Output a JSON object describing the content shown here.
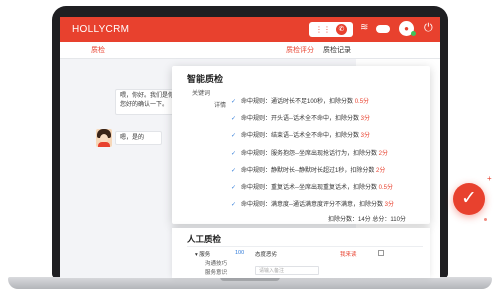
{
  "app": {
    "brand": "HOLLYCRM"
  },
  "topbar": {
    "grid_icon": "grid-icon",
    "phone_icon": "phone-icon",
    "wifi_icon": "wifi-icon",
    "avatar_icon": "user-avatar-icon",
    "power_icon": "power-icon",
    "accent": "#e8412e"
  },
  "tabs": {
    "qc": "质检",
    "score": "质检评分",
    "record": "质检记录"
  },
  "chat": {
    "agent_message": "喂，你好。我们是你您好的确认一下。",
    "customer_message": "嗯，是的"
  },
  "smart_qc": {
    "title": "智能质检",
    "keyword_label": "关键词",
    "detail_label": "详情",
    "rules": [
      {
        "text": "命中规则：通话时长不足100秒，扣除分数",
        "deduct": "0.5分"
      },
      {
        "text": "命中规则：开头语--话术全不命中，扣除分数",
        "deduct": "3分"
      },
      {
        "text": "命中规则：结束语--话术全不命中，扣除分数",
        "deduct": "3分"
      },
      {
        "text": "命中规则：服务抱怨--坐席出现抢话行为，扣除分数",
        "deduct": "2分"
      },
      {
        "text": "命中规则：静默时长--静默时长超过1秒，扣除分数",
        "deduct": "2分"
      },
      {
        "text": "命中规则：重复话术--坐席出现重复话术，扣除分数",
        "deduct": "0.5分"
      },
      {
        "text": "命中规则：满意度--通话满意度评分不满意，扣除分数",
        "deduct": "3分"
      }
    ],
    "summary": "扣除分数：14分    总分：110分"
  },
  "manual_qc": {
    "title": "人工质检",
    "service_label": "服务",
    "service_score": "100",
    "attitude_label": "态度恶劣",
    "deduct_label": "我来读",
    "sub_items": [
      "沟通技巧",
      "服务意识"
    ],
    "input_placeholder": "请输入备注"
  },
  "badge": {
    "icon": "check-icon"
  }
}
